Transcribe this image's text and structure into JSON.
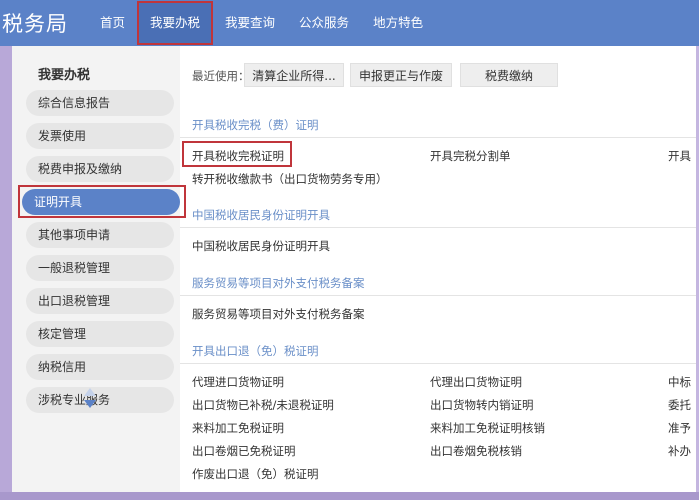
{
  "header": {
    "brand": "税务局",
    "nav": [
      {
        "label": "首页"
      },
      {
        "label": "我要办税"
      },
      {
        "label": "我要查询"
      },
      {
        "label": "公众服务"
      },
      {
        "label": "地方特色"
      }
    ],
    "active_nav": "我要办税"
  },
  "sidebar": {
    "title": "我要办税",
    "items": [
      {
        "label": "综合信息报告"
      },
      {
        "label": "发票使用"
      },
      {
        "label": "税费申报及缴纳"
      },
      {
        "label": "证明开具"
      },
      {
        "label": "其他事项申请"
      },
      {
        "label": "一般退税管理"
      },
      {
        "label": "出口退税管理"
      },
      {
        "label": "核定管理"
      },
      {
        "label": "纳税信用"
      },
      {
        "label": "涉税专业服务"
      }
    ],
    "active_item": "证明开具"
  },
  "recent": {
    "label": "最近使用：",
    "buttons": [
      {
        "label": "清算企业所得..."
      },
      {
        "label": "申报更正与作废"
      },
      {
        "label": "税费缴纳"
      }
    ]
  },
  "sections": [
    {
      "title": "开具税收完税（费）证明",
      "links": [
        {
          "label": "开具税收完税证明"
        },
        {
          "label": "开具完税分割单"
        },
        {
          "label": "开具"
        },
        {
          "label": "转开税收缴款书（出口货物劳务专用）"
        }
      ]
    },
    {
      "title": "中国税收居民身份证明开具",
      "links": [
        {
          "label": "中国税收居民身份证明开具"
        }
      ]
    },
    {
      "title": "服务贸易等项目对外支付税务备案",
      "links": [
        {
          "label": "服务贸易等项目对外支付税务备案"
        }
      ]
    },
    {
      "title": "开具出口退（免）税证明",
      "links": [
        {
          "label": "代理进口货物证明"
        },
        {
          "label": "代理出口货物证明"
        },
        {
          "label": "中标"
        },
        {
          "label": "出口货物已补税/未退税证明"
        },
        {
          "label": "出口货物转内销证明"
        },
        {
          "label": "委托"
        },
        {
          "label": "来料加工免税证明"
        },
        {
          "label": "来料加工免税证明核销"
        },
        {
          "label": "准予"
        },
        {
          "label": "出口卷烟已免税证明"
        },
        {
          "label": "出口卷烟免税核销"
        },
        {
          "label": "补办"
        },
        {
          "label": "作废出口退（免）税证明"
        }
      ]
    }
  ],
  "colors": {
    "nav_bg": "#5b82c8",
    "accent": "#5b82c8",
    "section_title": "#6a8fc8",
    "highlight_border": "#c0353b",
    "frame": "#b8a8d8"
  },
  "icons": {
    "scroll_up": "triangle-up-icon",
    "scroll_down": "triangle-down-icon"
  }
}
